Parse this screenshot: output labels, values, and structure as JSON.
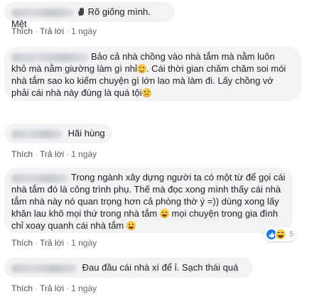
{
  "comments": [
    {
      "text": "Rõ giống mình. Mệt",
      "lead_icon": "waving-hand-icon",
      "actions": {
        "like": "Thích",
        "reply": "Trả lời",
        "sep": "·",
        "time": "1 ngày"
      }
    },
    {
      "lines": [
        "Bảo cả nhà chồng vào nhà tắm mà nằm luôn",
        "khỏ mà nằm giường làm gì nhỉ",
        "Cái thời gian chăm chăm soi mói",
        "nhà tắm sao ko kiếm chuyện gì lớn lao mà làm đi. Lấy chồng vớ",
        "phải cái nhà này đúng là quá tội"
      ],
      "emoji": [
        "smirk-emoji-icon",
        "sad-emoji-icon"
      ]
    },
    {
      "text": "Hãi hùng",
      "actions": {
        "like": "Thích",
        "reply": "Trả lời",
        "sep": "·",
        "time": "1 ngày"
      }
    },
    {
      "lines": [
        "Trong ngành xây dựng người ta có một từ để gọi cái",
        "nhà tắm đó là công trình phụ. Thế mà đọc xong mình thấy cái nhà",
        "tắm nhà này nó quan trọng hơn cả phòng thờ ý =)) dùng xong lấy",
        "khăn lau khô mọi thứ trong nhà tắm",
        "mọi chuyện trong gia đình",
        "chỉ xoay quanh cái nhà tắm"
      ],
      "emoji": [
        "laughing-emoji-icon",
        "laughing-emoji-icon"
      ],
      "reactions": {
        "icons": [
          "like-reaction-icon",
          "haha-reaction-icon"
        ],
        "count": "5"
      },
      "actions": {
        "like": "Thích",
        "reply": "Trả lời",
        "sep": "·",
        "time": "1 ngày"
      }
    },
    {
      "text": "Đau đầu cái nhà xí để ỉ. Sạch thái quá",
      "actions": {
        "like": "Thích",
        "reply": "Trả lời",
        "sep": "·",
        "time": "1 ngày"
      }
    }
  ]
}
